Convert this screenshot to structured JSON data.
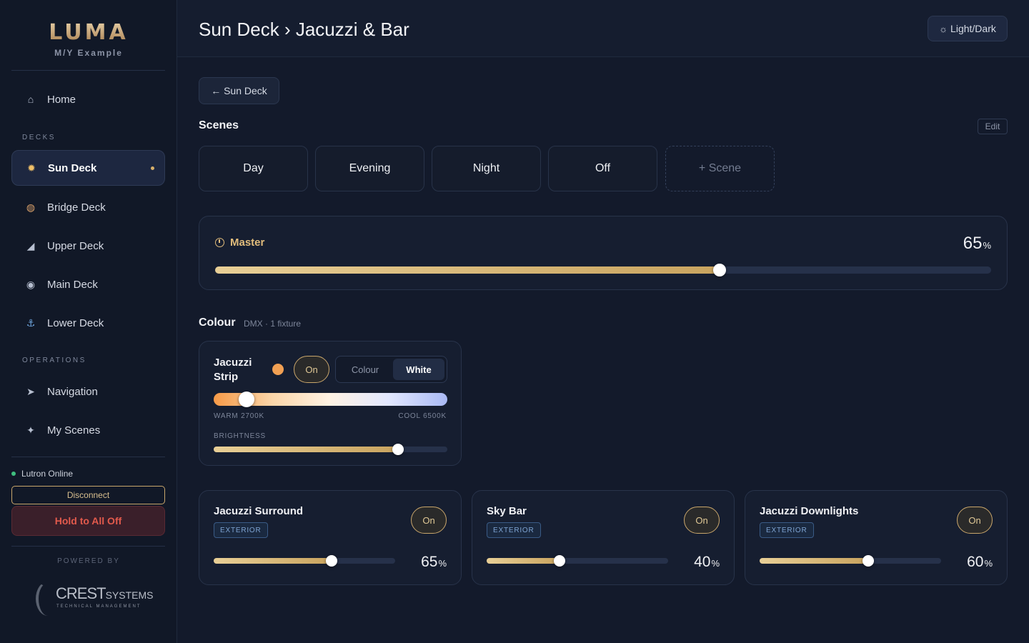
{
  "brand": {
    "logo": "LUMA",
    "subtitle": "M/Y Example"
  },
  "nav": {
    "home": {
      "label": "Home",
      "icon": "home-icon"
    },
    "decks_label": "DECKS",
    "decks": [
      {
        "label": "Sun Deck",
        "icon": "sun-icon",
        "active": true
      },
      {
        "label": "Bridge Deck",
        "icon": "compass-icon"
      },
      {
        "label": "Upper Deck",
        "icon": "boat-icon"
      },
      {
        "label": "Main Deck",
        "icon": "dining-icon"
      },
      {
        "label": "Lower Deck",
        "icon": "anchor-icon"
      }
    ],
    "operations_label": "OPERATIONS",
    "operations": [
      {
        "label": "Navigation",
        "icon": "arrow-icon"
      },
      {
        "label": "My Scenes",
        "icon": "sparkle-icon"
      }
    ]
  },
  "status": {
    "text": "Lutron Online",
    "color": "#3fbf7f"
  },
  "buttons": {
    "disconnect": "Disconnect",
    "all_off": "Hold to All Off",
    "back": "← Sun Deck",
    "theme": "Light/Dark",
    "edit": "Edit"
  },
  "powered_by": "POWERED BY",
  "crest": {
    "name": "CREST",
    "name_suffix": "SYSTEMS",
    "tagline": "TECHNICAL MANAGEMENT"
  },
  "header": {
    "title": "Sun Deck › Jacuzzi & Bar"
  },
  "scenes": {
    "title": "Scenes",
    "items": [
      "Day",
      "Evening",
      "Night",
      "Off"
    ],
    "add_label": "+ Scene"
  },
  "master": {
    "label": "Master",
    "value": 65,
    "value_text": "65",
    "unit": "%"
  },
  "colour": {
    "title": "Colour",
    "subtitle": "DMX · 1 fixture",
    "fixture": {
      "name": "Jacuzzi Strip",
      "swatch": "#f1a053",
      "on_label": "On",
      "mode_colour": "Colour",
      "mode_white": "White",
      "temp_fraction": 0.14,
      "warm_label": "WARM 2700K",
      "cool_label": "COOL 6500K",
      "brightness_label": "BRIGHTNESS",
      "brightness": 79
    }
  },
  "fixtures": [
    {
      "name": "Jacuzzi Surround",
      "badge": "EXTERIOR",
      "on_label": "On",
      "value": 65,
      "value_text": "65",
      "unit": "%"
    },
    {
      "name": "Sky Bar",
      "badge": "EXTERIOR",
      "on_label": "On",
      "value": 40,
      "value_text": "40",
      "unit": "%"
    },
    {
      "name": "Jacuzzi Downlights",
      "badge": "EXTERIOR",
      "on_label": "On",
      "value": 60,
      "value_text": "60",
      "unit": "%"
    }
  ],
  "colors": {
    "accent": "#c9a66b",
    "background": "#131a2b",
    "danger": "#e25a4c"
  }
}
